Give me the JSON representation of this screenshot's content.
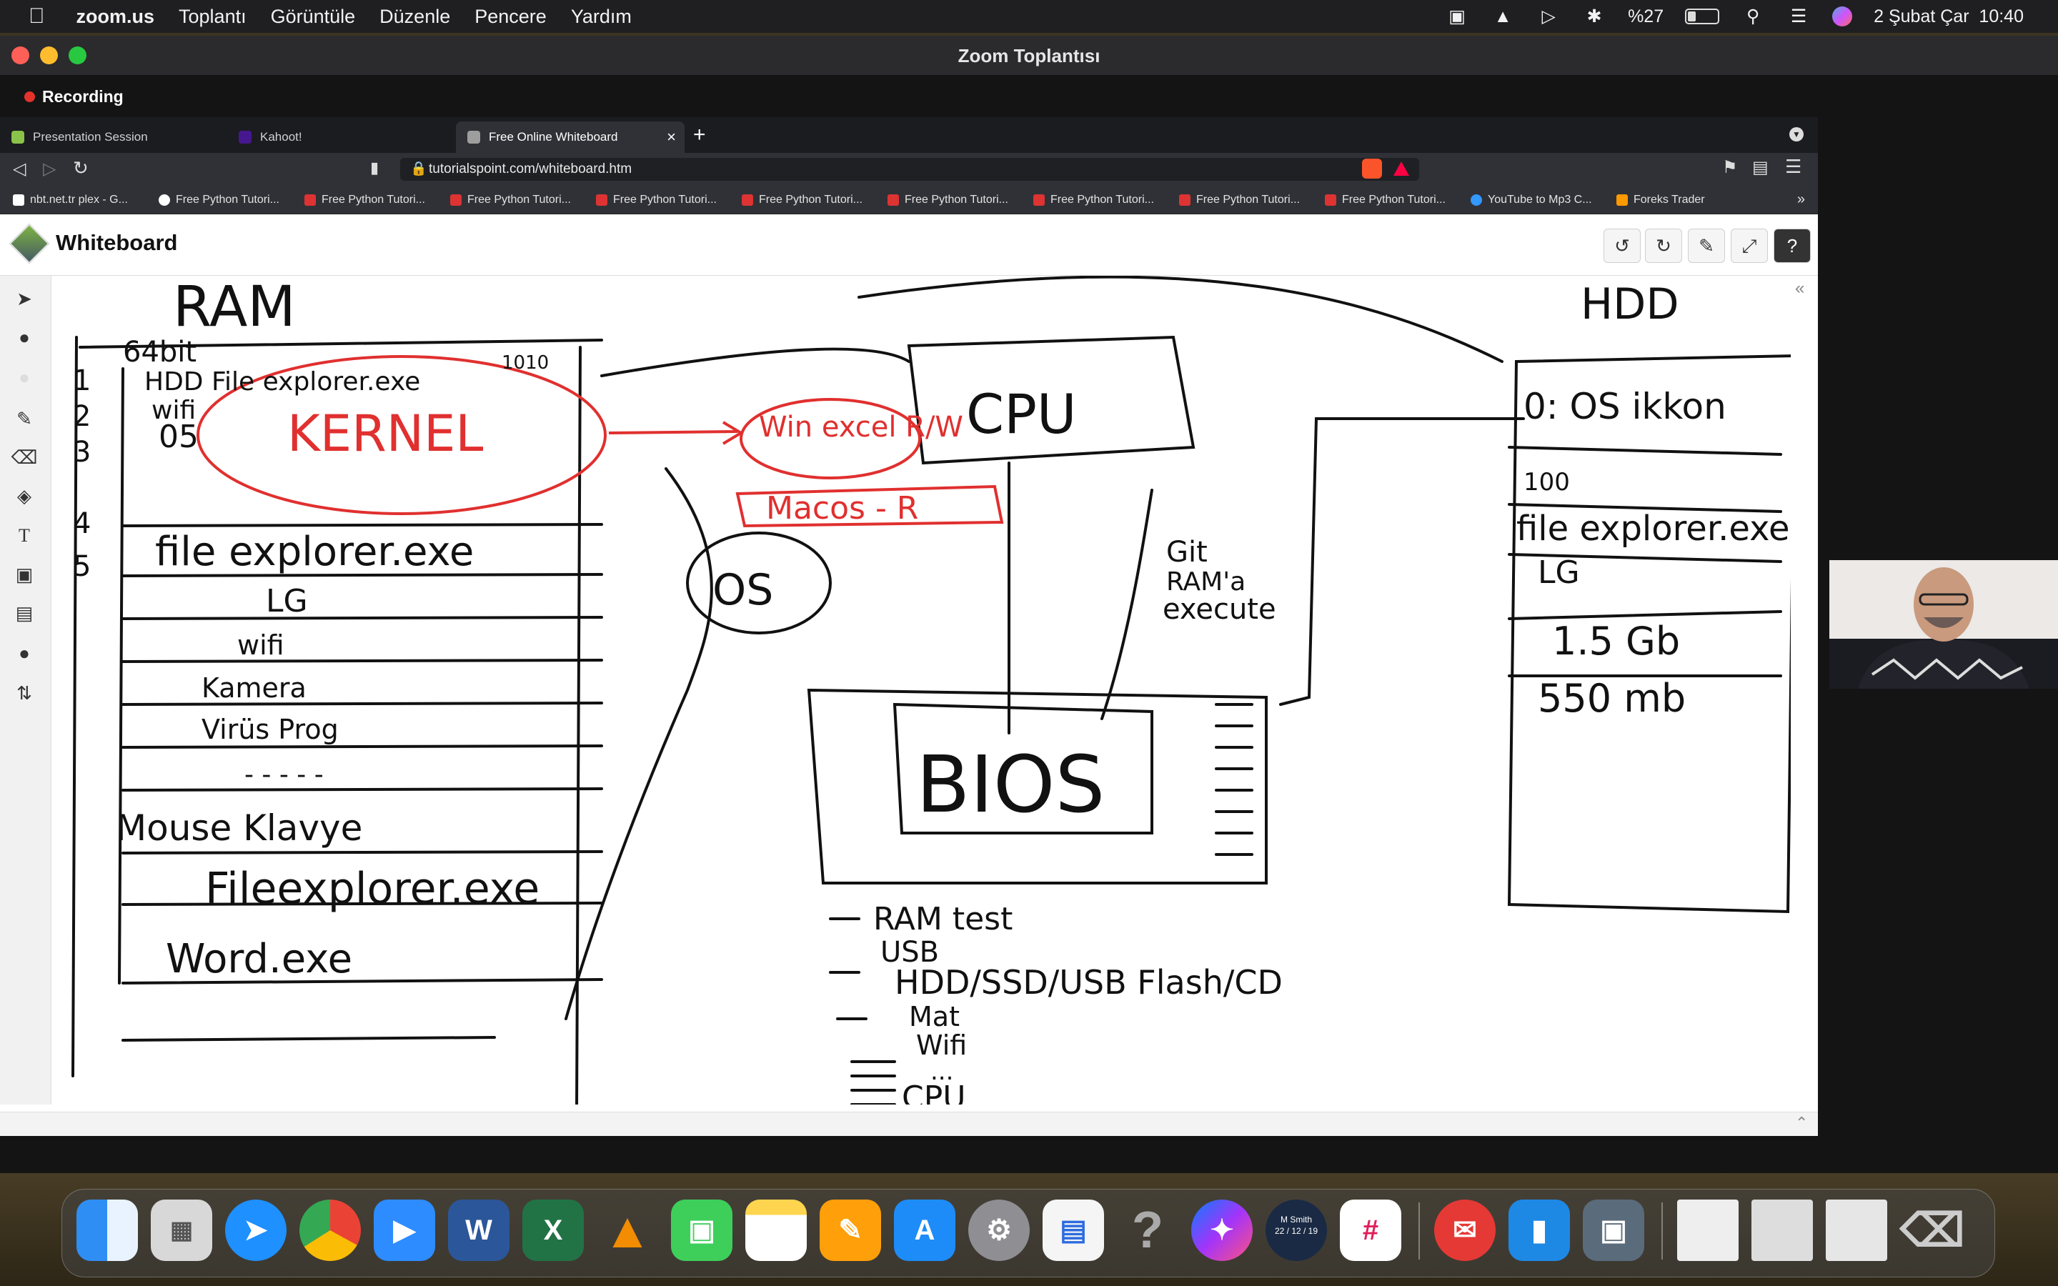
{
  "menubar": {
    "app": "zoom.us",
    "items": [
      "Toplantı",
      "Görüntüle",
      "Düzenle",
      "Pencere",
      "Yardım"
    ],
    "battery": "%27",
    "datetime": "2 Şubat Çar  10:40"
  },
  "window": {
    "title": "Zoom Toplantısı",
    "recording": "Recording"
  },
  "browser": {
    "tabs": [
      "Presentation Session",
      "Kahoot!",
      "Free Online Whiteboard"
    ],
    "url": "tutorialspoint.com/whiteboard.htm",
    "bookmarks": [
      "nbt.net.tr plex - G...",
      "Free Python Tutori...",
      "Free Python Tutori...",
      "Free Python Tutori...",
      "Free Python Tutori...",
      "Free Python Tutori...",
      "Free Python Tutori...",
      "Free Python Tutori...",
      "Free Python Tutori...",
      "Free Python Tutori...",
      "YouTube to Mp3 C...",
      "Foreks Trader"
    ]
  },
  "whiteboard": {
    "title": "Whiteboard",
    "header_buttons": [
      "undo-icon",
      "redo-icon",
      "brush-icon",
      "fullscreen-icon",
      "help-icon"
    ],
    "tools": [
      "pointer-icon",
      "fill-circle-icon",
      "empty-circle-icon",
      "pen-icon",
      "eraser-icon",
      "shapes-icon",
      "text-icon",
      "image-icon",
      "image-add-icon",
      "chat-icon",
      "arrows-icon"
    ]
  },
  "drawing": {
    "ram": {
      "title": "RAM",
      "rows": [
        "64bit",
        "HDD File explorer.exe",
        "wifi",
        "05",
        "file explorer.exe",
        "LG",
        "wifi",
        "Kamera",
        "Virüs Prog",
        "- - - - -",
        "Mouse Klavye",
        "Fileexplorer.exe",
        "Word.exe"
      ],
      "numbers": [
        "1",
        "2",
        "3",
        "4",
        "5"
      ],
      "corner_note": "1010"
    },
    "red_annotations": [
      "KERNEL",
      "Win excel R/W",
      "Macos - R"
    ],
    "os_label": "OS",
    "cpu_label": "CPU",
    "git_note": [
      "Git",
      "RAM'a",
      "execute"
    ],
    "bios_label": "BIOS",
    "bios_list": [
      "RAM test",
      "USB",
      "HDD/SSD/USB Flash/CD",
      "Mat",
      "Wifi",
      "..."
    ],
    "bios_last": "CPU",
    "hdd": {
      "title": "HDD",
      "rows": [
        "0: OS ikkon",
        "100",
        "file explorer.exe",
        "LG",
        "1.5 Gb",
        "550 mb"
      ]
    }
  },
  "dock": {
    "mail_badge": "",
    "calendar_label": "M Smith",
    "calendar_date": "22 / 12 / 19"
  },
  "colors": {
    "pen": "#111111",
    "red": "#e0302f",
    "menubar": "#1f1f21"
  }
}
